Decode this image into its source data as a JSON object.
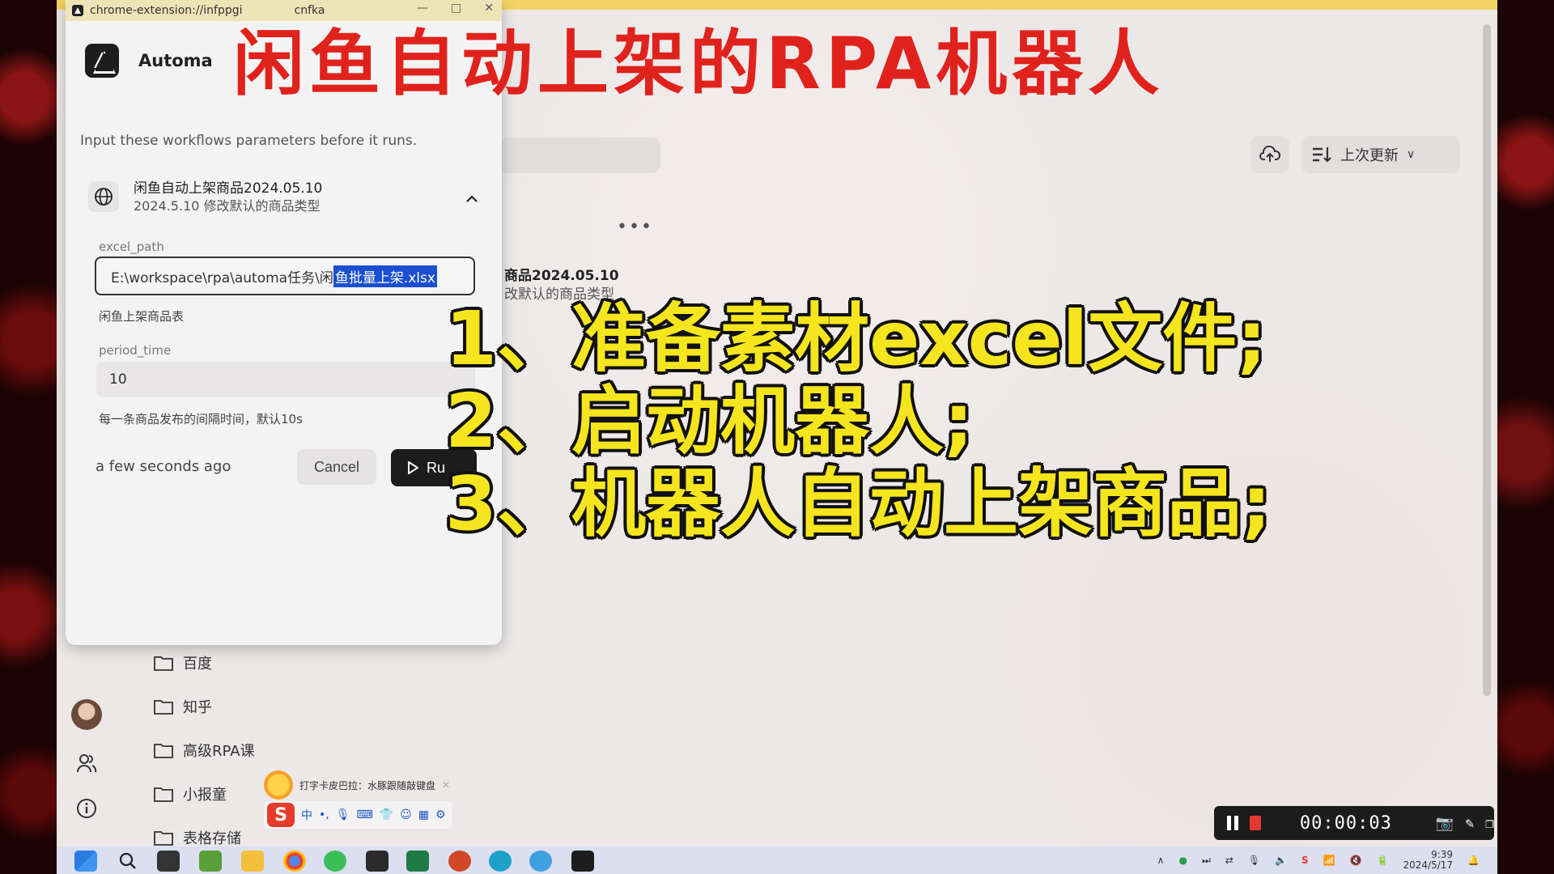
{
  "overlay": {
    "title": "闲鱼自动上架的RPA机器人",
    "steps": [
      "1、准备素材excel文件;",
      "2、启动机器人;",
      "3、机器人自动上架商品;"
    ]
  },
  "window": {
    "url": "chrome-extension://infppgi",
    "url_tail": "cnfka",
    "min": "—",
    "max": "□",
    "close": "✕"
  },
  "popup": {
    "app_name": "Automa",
    "intro": "Input these workflows parameters before it runs.",
    "workflow": {
      "name": "闲鱼自动上架商品2024.05.10",
      "desc": "2024.5.10 修改默认的商品类型"
    },
    "params": [
      {
        "label": "excel_path",
        "value_prefix": "E:\\workspace\\rpa\\automa任务\\闲",
        "value_selected": "鱼批量上架.xlsx",
        "hint": "闲鱼上架商品表"
      },
      {
        "label": "period_time",
        "value": "10",
        "hint": "每一条商品发布的间隔时间，默认10s"
      }
    ],
    "timestamp": "a few seconds ago",
    "cancel_label": "Cancel",
    "run_label": "Ru"
  },
  "background": {
    "sort_label": "上次更新",
    "card_title": "商品2024.05.10",
    "card_sub": "改默认的商品类型",
    "folders": [
      "百度",
      "知乎",
      "高级RPA课",
      "小报童",
      "表格存储"
    ]
  },
  "ime": {
    "hint": "打字卡皮巴拉：水豚跟随敲键盘",
    "mode": "中"
  },
  "recorder": {
    "time": "00:00:03"
  },
  "taskbar": {
    "time": "9:39",
    "date": "2024/5/17"
  },
  "colors": {
    "title_red": "#e0221d",
    "step_yellow": "#f4e51e",
    "selection_blue": "#1b4fd1",
    "run_button": "#1c1c1c"
  }
}
